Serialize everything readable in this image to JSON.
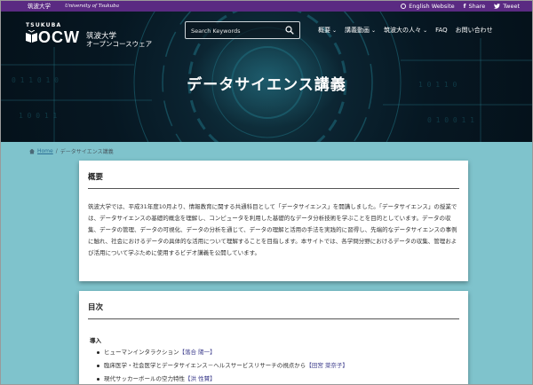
{
  "topbar": {
    "university_jp": "筑波大学",
    "university_en": "University of Tsukuba",
    "links": [
      {
        "label": "English Website",
        "icon": "globe-icon"
      },
      {
        "label": "Share",
        "icon": "facebook-icon"
      },
      {
        "label": "Tweet",
        "icon": "twitter-icon"
      }
    ]
  },
  "header": {
    "logo_top": "TSUKUBA",
    "logo_main": "OCW",
    "logo_jp_line1": "筑波大学",
    "logo_jp_line2": "オープンコースウェア",
    "search_placeholder": "Search Keywords",
    "nav": [
      {
        "label": "概要",
        "has_dropdown": true
      },
      {
        "label": "講義動画",
        "has_dropdown": true
      },
      {
        "label": "筑波大の人々",
        "has_dropdown": true
      },
      {
        "label": "FAQ",
        "has_dropdown": false
      },
      {
        "label": "お問い合わせ",
        "has_dropdown": false
      }
    ]
  },
  "hero": {
    "title": "データサイエンス講義"
  },
  "breadcrumb": {
    "home": "Home",
    "separator": "/",
    "current": "データサイエンス講義"
  },
  "overview": {
    "heading": "概要",
    "body": "筑波大学では、平成31年度10月より、情報教育に関する共通科目として「データサイエンス」を開講しました。「データサイエンス」の授業では、データサイエンスの基礎的概念を理解し、コンピュータを利用した基礎的なデータ分析技術を学ぶことを目的としています。データの収集、データの管理、データの可視化、データの分析を通じて、データの理解と活用の手法を実践的に習得し、先端的なデータサイエンスの事例に触れ、社会におけるデータの具体的な活用について理解することを目指します。本サイトでは、各学問分野におけるデータの収集、管理および活用について学ぶために使用するビデオ講義を公開しています。"
  },
  "toc": {
    "heading": "目次",
    "section": "導入",
    "items": [
      {
        "title": "ヒューマンインタラクション",
        "lecturer": "【落合 陽一】"
      },
      {
        "title": "臨床医学・社会医学とデータサイエンス－ヘルスサービスリサーチの視点から",
        "lecturer": "【田宮 菜奈子】"
      },
      {
        "title": "現代サッカーボールの空力特性",
        "lecturer": "【洪 性賛】"
      }
    ]
  },
  "colors": {
    "topbar": "#5a2a82",
    "hero_dark": "#05121b",
    "page_bg": "#7fc3cc"
  }
}
